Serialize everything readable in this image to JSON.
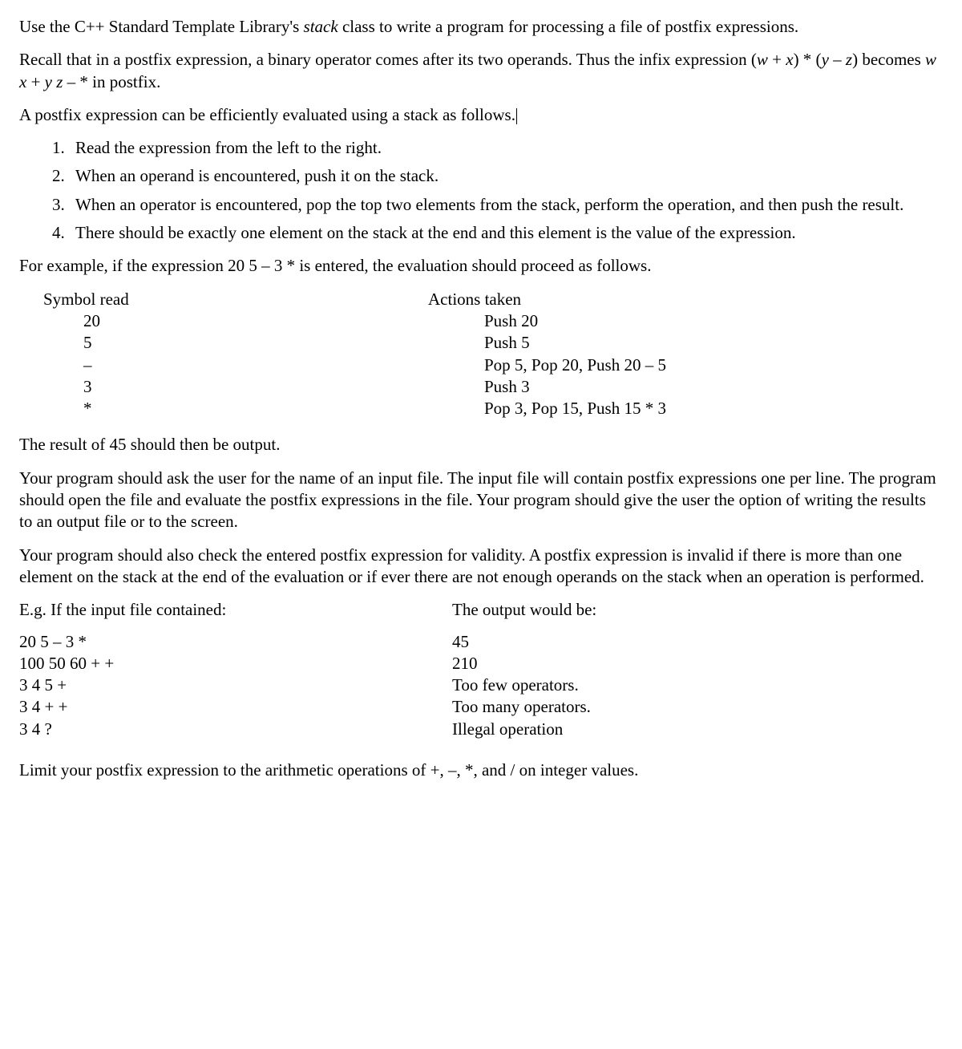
{
  "intro1_a": "Use the C++ Standard Template Library's ",
  "intro1_b": "stack",
  "intro1_c": " class to write a program for processing a file of postfix expressions.",
  "intro2_a": "Recall that in a postfix expression, a binary operator comes after its two operands.  Thus the infix expression (",
  "intro2_b": "w",
  "intro2_c": " + ",
  "intro2_d": "x",
  "intro2_e": ") * (",
  "intro2_f": "y",
  "intro2_g": " – ",
  "intro2_h": "z",
  "intro2_i": ") becomes ",
  "intro2_j": "w x",
  "intro2_k": " + ",
  "intro2_l": "y z",
  "intro2_m": " – * in postfix.",
  "intro3": "A postfix expression can be efficiently evaluated using a stack as follows.",
  "steps": [
    "Read the expression from the left to the right.",
    "When an operand is encountered, push it on the stack.",
    "When an operator is encountered, pop the top two elements from the stack, perform the operation, and then push the result.",
    "There should be exactly one element on the stack at the end and this element is the value of the expression."
  ],
  "example_intro": "For example, if the expression 20 5 – 3 * is entered, the evaluation should proceed as follows.",
  "trace_header1": "Symbol read",
  "trace_header2": "Actions taken",
  "trace": [
    {
      "sym": "20",
      "act": "Push 20"
    },
    {
      "sym": "5",
      "act": "Push 5"
    },
    {
      "sym": "–",
      "act": "Pop 5, Pop 20, Push 20 – 5"
    },
    {
      "sym": "3",
      "act": "Push 3"
    },
    {
      "sym": "*",
      "act": "Pop 3, Pop 15, Push 15 * 3"
    }
  ],
  "result_line": "The result of 45 should then be output.",
  "para_file": "Your program should ask the user for the name of an input file.  The input file will contain postfix expressions one per line.  The program should open the file and evaluate the postfix expressions in the file.  Your program should give the user the option of writing the results to an output file or to the screen.",
  "para_valid": "Your program should also check the entered postfix expression for validity.  A postfix expression is invalid if there is more than one element on the stack at the end of the evaluation or if ever there are not enough operands on the stack when an operation is performed.",
  "io_header1": "E.g.  If the input file contained:",
  "io_header2": "The output would be:",
  "io": [
    {
      "in": "20  5  –  3  *",
      "out": "45"
    },
    {
      "in": "100  50  60  +  +",
      "out": "210"
    },
    {
      "in": "3  4  5  +",
      "out": "Too few operators."
    },
    {
      "in": "3  4  +  +",
      "out": "Too many operators."
    },
    {
      "in": "3  4  ?",
      "out": "Illegal operation"
    }
  ],
  "limit": "Limit your postfix expression to the arithmetic operations of +, –, *, and / on integer values."
}
